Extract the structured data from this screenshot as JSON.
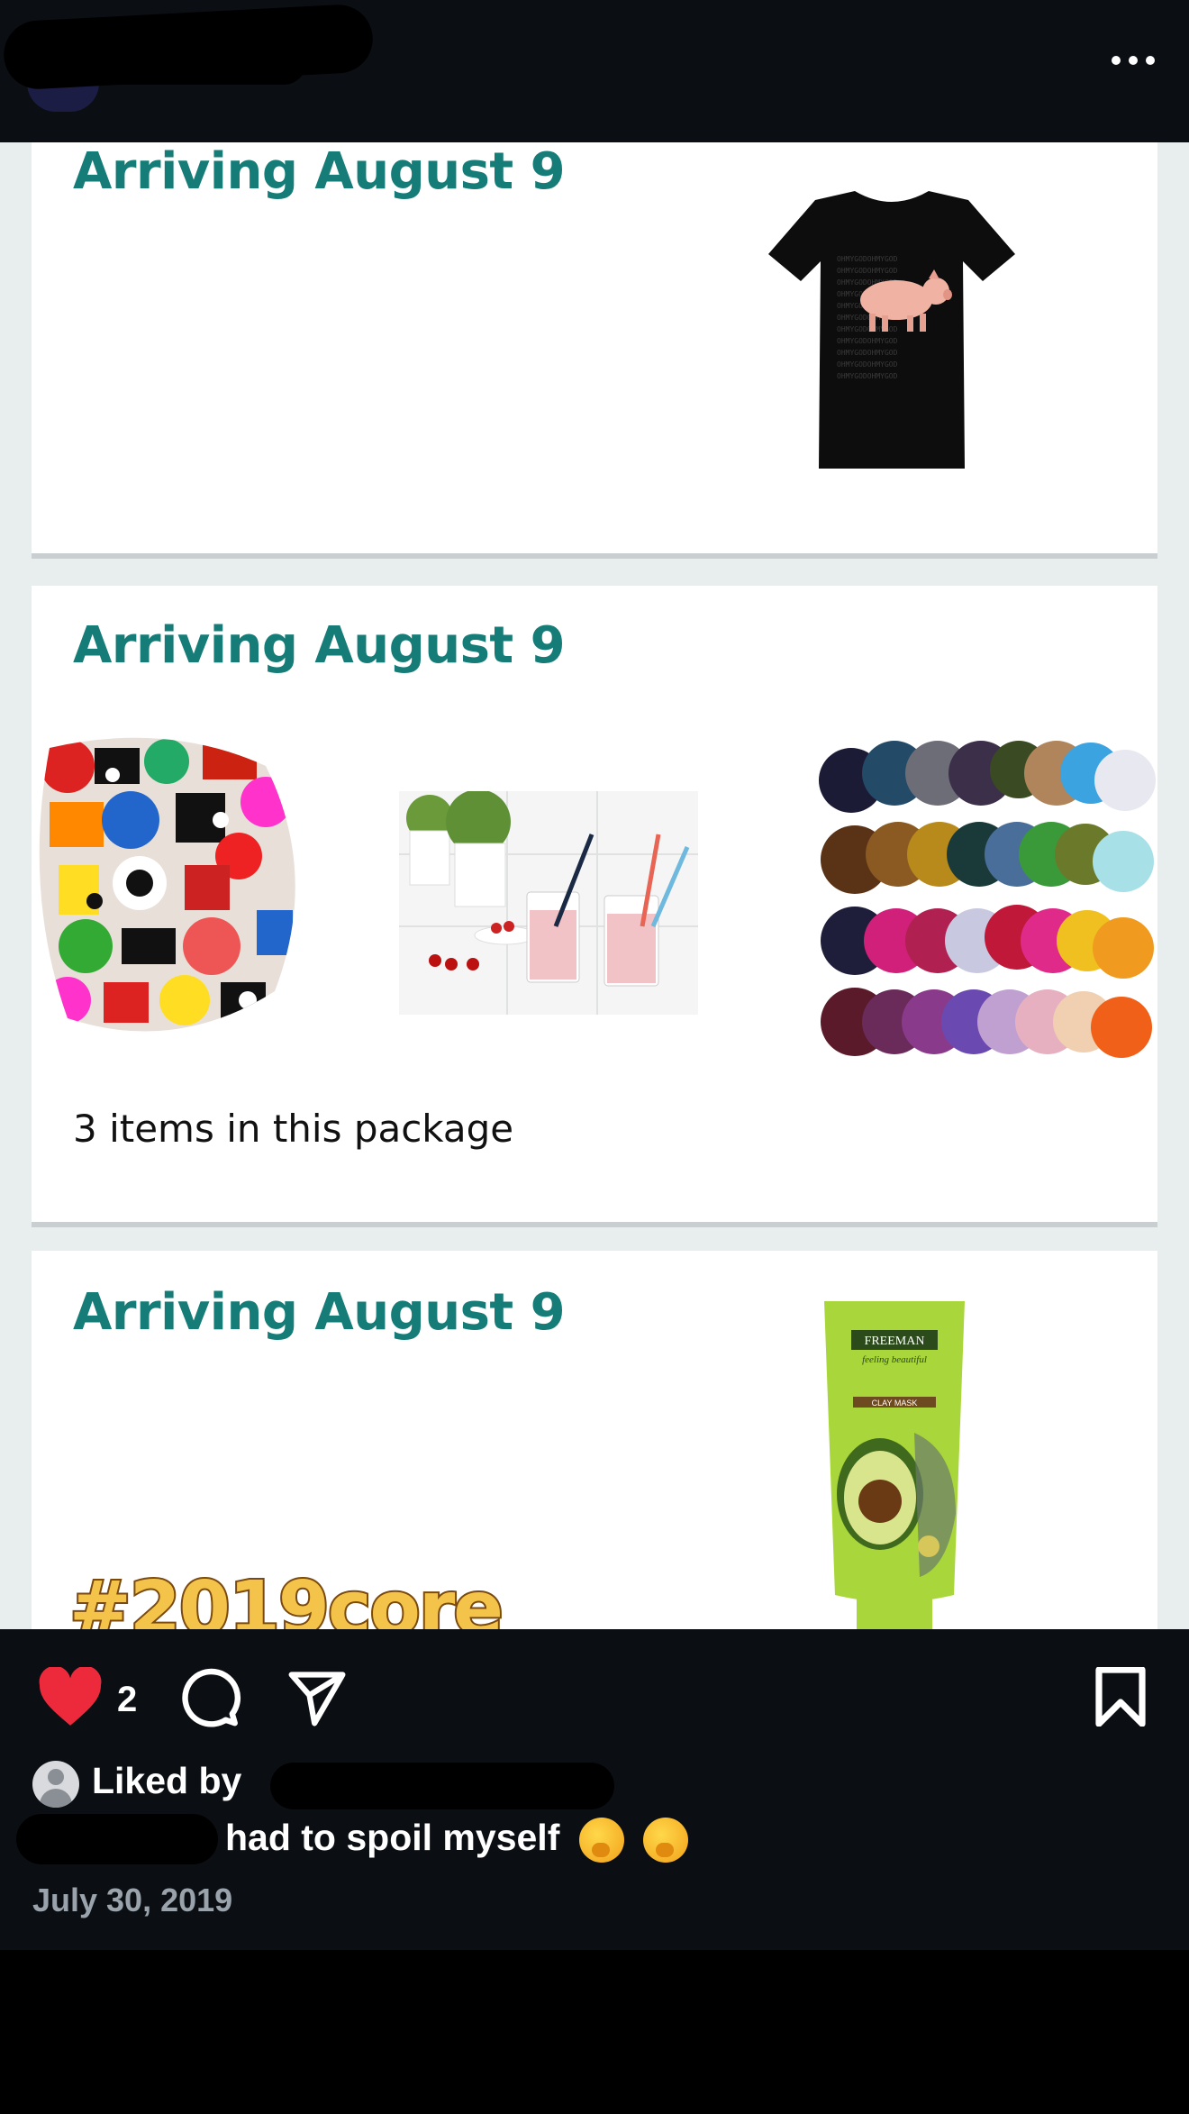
{
  "header": {
    "username": "[redacted]",
    "more_icon": "more-horizontal-icon"
  },
  "post": {
    "cards": [
      {
        "heading": "Arriving August 9",
        "items": [
          "pig-tshirt"
        ]
      },
      {
        "heading": "Arriving August 9",
        "items": [
          "sticker-pack",
          "smoothie-straws",
          "scrunchies"
        ],
        "footer": "3 items in this package"
      },
      {
        "heading": "Arriving August 9",
        "items": [
          "avocado-clay-mask"
        ]
      }
    ],
    "tshirt_print": "OHMYGODOHMYGOD",
    "mask_brand": "FREEMAN",
    "mask_sub": "feeling beautiful",
    "mask_type": "CLAY MASK",
    "hashtag": "#2019core"
  },
  "actions": {
    "like_icon": "heart-filled-icon",
    "like_count": "2",
    "comment_icon": "comment-icon",
    "share_icon": "send-icon",
    "save_icon": "bookmark-icon",
    "liked_by_prefix": "Liked by",
    "caption": "had to spoil myself",
    "date": "July 30, 2019"
  },
  "colors": {
    "heading_teal": "#167c78",
    "like_red": "#ed2a3b",
    "bar_bg": "#0b0f14"
  }
}
